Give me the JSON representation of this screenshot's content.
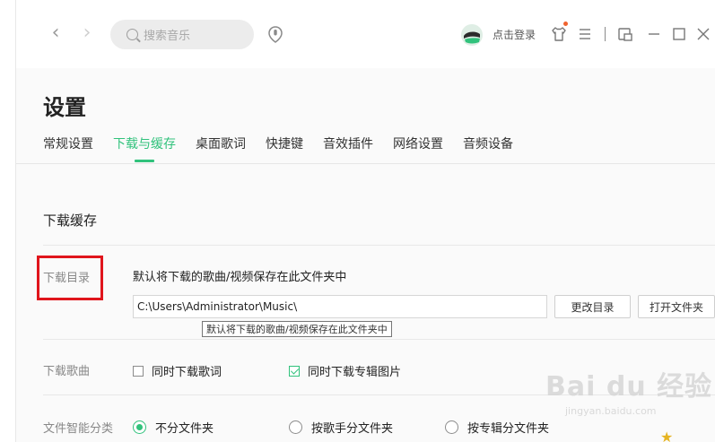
{
  "topbar": {
    "search_placeholder": "搜索音乐",
    "login_label": "点击登录"
  },
  "page": {
    "title": "设置"
  },
  "tabs": [
    {
      "label": "常规设置",
      "active": false
    },
    {
      "label": "下载与缓存",
      "active": true
    },
    {
      "label": "桌面歌词",
      "active": false
    },
    {
      "label": "快捷键",
      "active": false
    },
    {
      "label": "音效插件",
      "active": false
    },
    {
      "label": "网络设置",
      "active": false
    },
    {
      "label": "音频设备",
      "active": false
    }
  ],
  "section": {
    "title": "下载缓存"
  },
  "download_dir": {
    "label": "下载目录",
    "description": "默认将下载的歌曲/视频保存在此文件夹中",
    "path": "C:\\Users\\Administrator\\Music\\",
    "change_button": "更改目录",
    "open_button": "打开文件夹",
    "tooltip": "默认将下载的歌曲/视频保存在此文件夹中"
  },
  "download_song": {
    "label": "下载歌曲",
    "option_lyrics": {
      "label": "同时下载歌词",
      "checked": false
    },
    "option_cover": {
      "label": "同时下载专辑图片",
      "checked": true
    }
  },
  "file_classify": {
    "label": "文件智能分类",
    "options": [
      {
        "label": "不分文件夹",
        "selected": true
      },
      {
        "label": "按歌手分文件夹",
        "selected": false
      },
      {
        "label": "按专辑分文件夹",
        "selected": false
      }
    ]
  },
  "watermark": {
    "text": "Bai du 经验",
    "sub": "jingyan.baidu.com"
  },
  "colors": {
    "accent": "#31c27c",
    "highlight_red": "#e0151c"
  }
}
